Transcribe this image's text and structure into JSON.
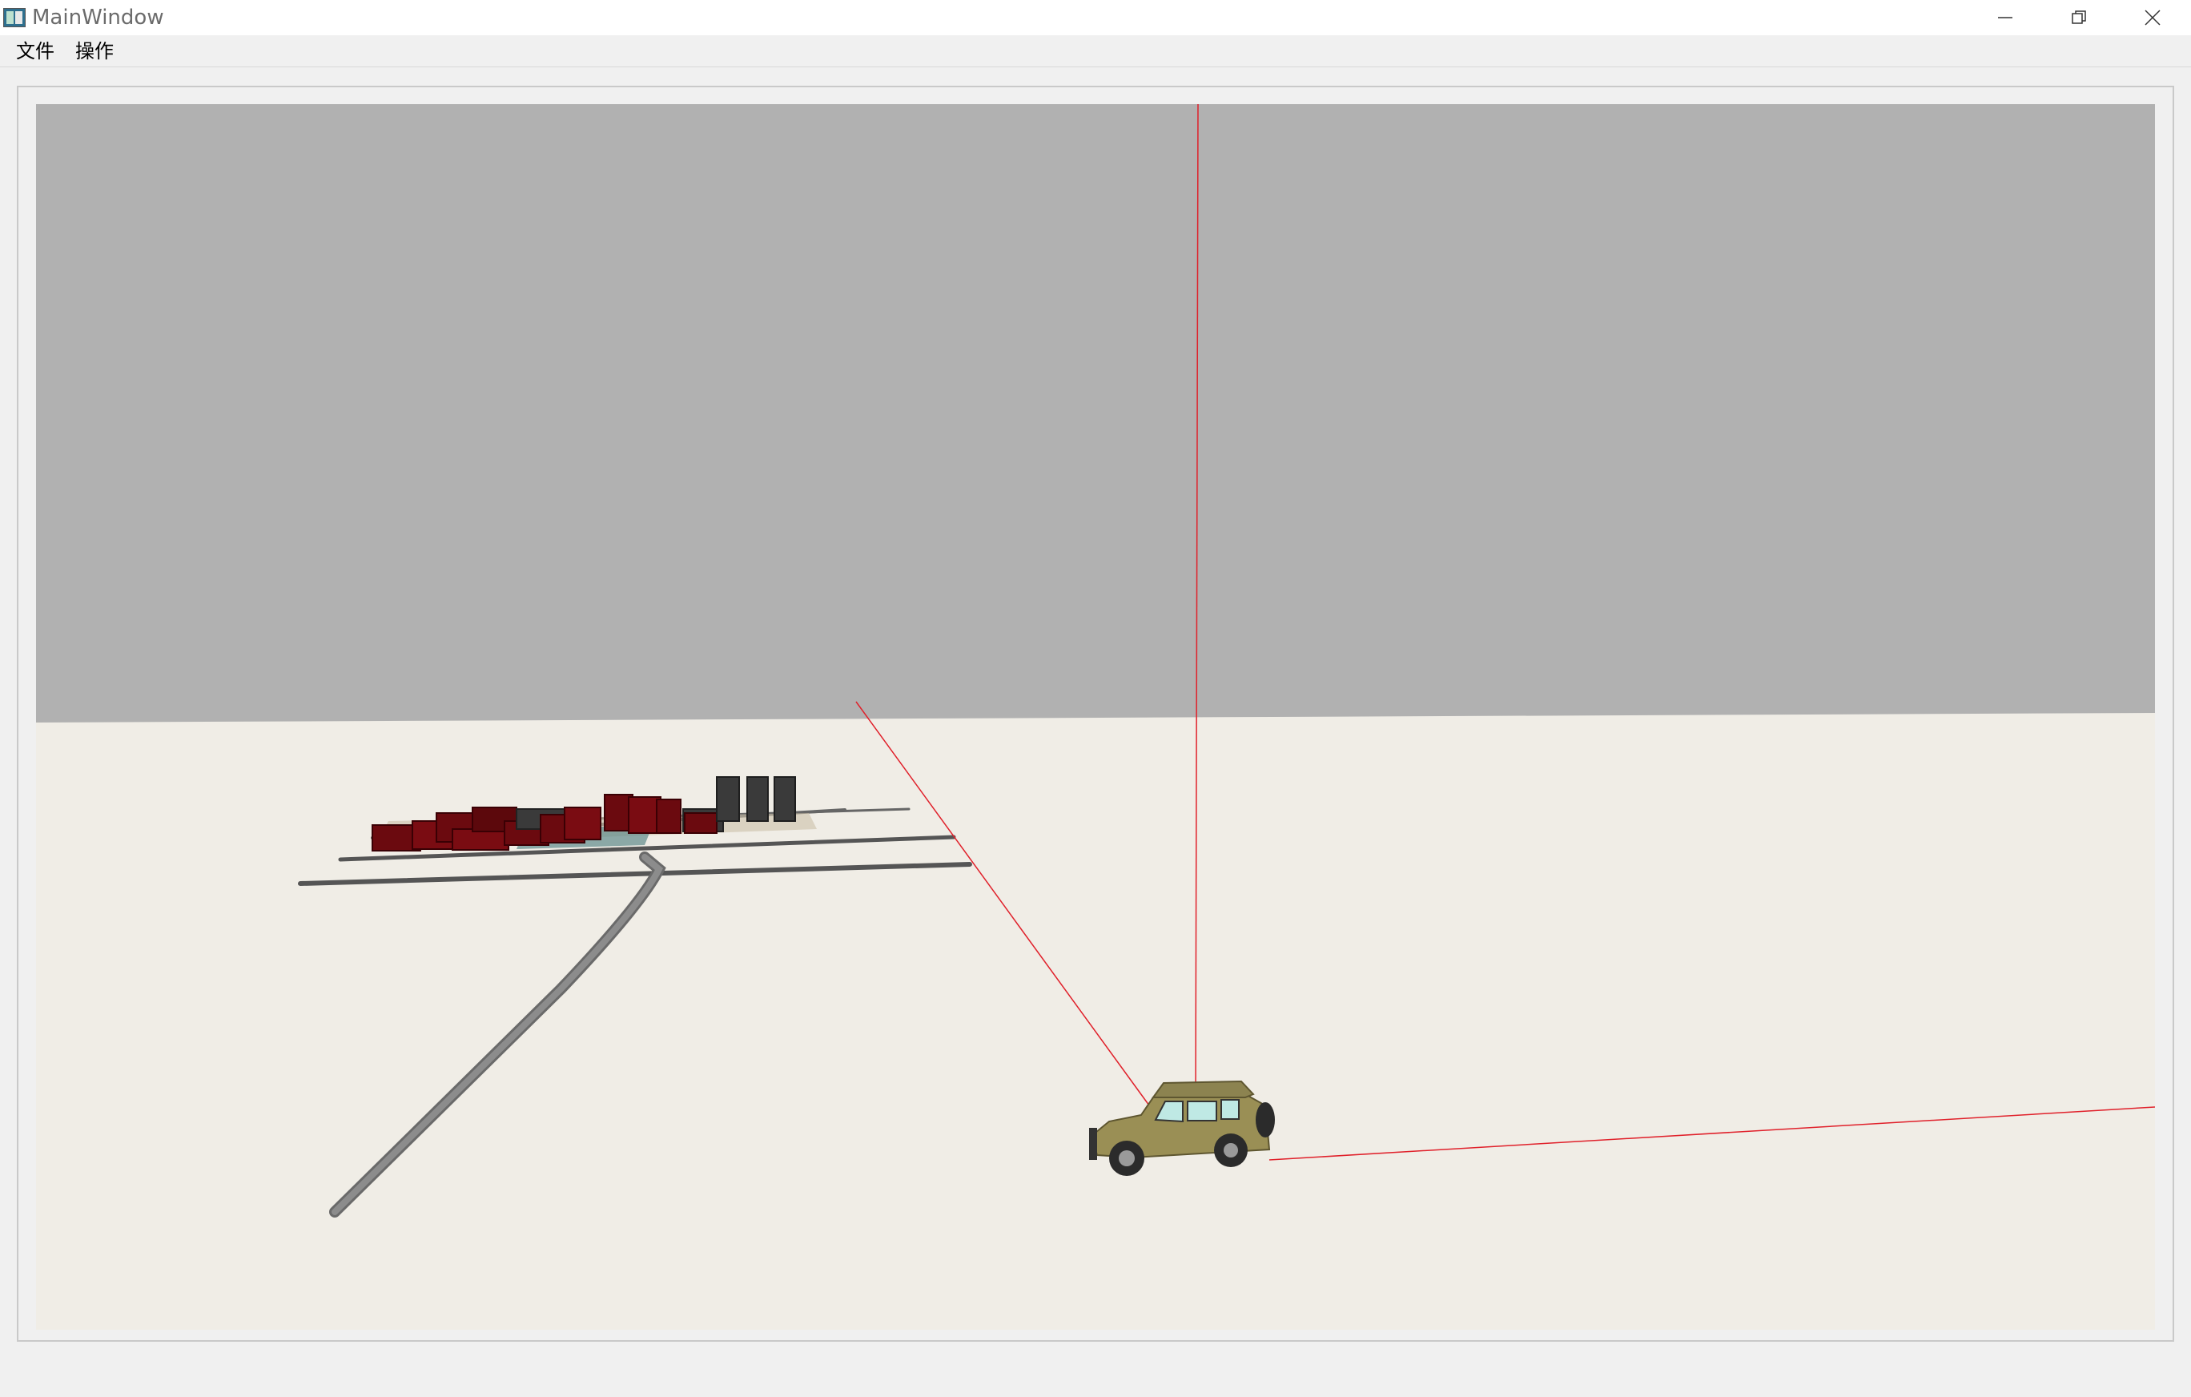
{
  "window": {
    "title": "MainWindow",
    "icon": "app-window-icon",
    "controls": {
      "minimize_icon": "minimize-icon",
      "restore_icon": "restore-icon",
      "close_icon": "close-icon"
    }
  },
  "menubar": {
    "items": [
      {
        "label": "文件"
      },
      {
        "label": "操作"
      }
    ]
  },
  "scene": {
    "sky_color": "#b1b1b1",
    "ground_color": "#f0ede6",
    "axis_color": "#e0202a",
    "building_color": "#6b0a0f",
    "tower_color": "#3a3a3a",
    "road_color": "#7a7a7a",
    "vehicle_color": "#9a8f55",
    "objects": [
      "city-block",
      "roads",
      "jeep-vehicle",
      "axis-lines"
    ]
  }
}
